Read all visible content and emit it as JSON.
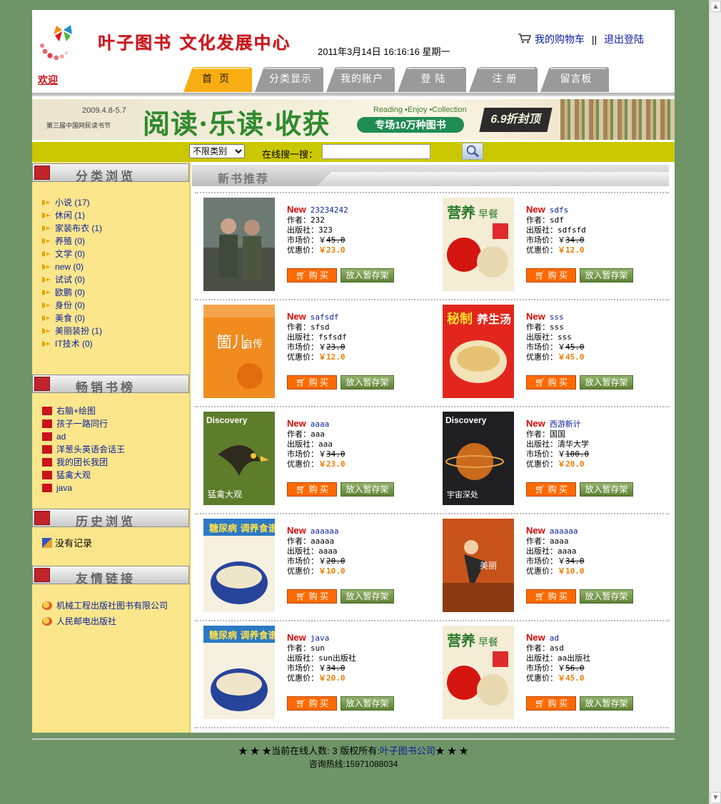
{
  "header": {
    "site_title": "叶子图书 文化发展中心",
    "datetime": "2011年3月14日  16:16:16 星期一",
    "cart_link": "我的购物车",
    "separator": "||",
    "logout_link": "退出登陆",
    "welcome": "欢迎"
  },
  "nav": {
    "tabs": [
      {
        "label": "首页"
      },
      {
        "label": "分类显示"
      },
      {
        "label": "我的账户"
      },
      {
        "label": "登 陆"
      },
      {
        "label": "注 册"
      },
      {
        "label": "留言板"
      }
    ]
  },
  "banner": {
    "date": "2009.4.8-5.7",
    "subtitle": "第三届中国网民读书节",
    "headline": "阅读·乐读·收获",
    "english": "Reading •Enjoy •Collection",
    "promo": "专场10万种图书",
    "discount": "6.9折封顶"
  },
  "search": {
    "category_selected": "不限类别",
    "label": "在线搜一搜：",
    "query": ""
  },
  "sidebar": {
    "category_title": "分类浏览",
    "categories": [
      "小说 (17)",
      "休闲 (1)",
      "家装布衣 (1)",
      "养殖 (0)",
      "文学 (0)",
      "new (0)",
      "试试 (0)",
      "欧鹏 (0)",
      "身份 (0)",
      "美食 (0)",
      "美丽装扮 (1)",
      "IT技术 (0)"
    ],
    "bestseller_title": "畅销书榜",
    "bestsellers": [
      "右脑+绘图",
      "孩子一路同行",
      "ad",
      "洋葱头英语会话王",
      "我的团长我团",
      "猛禽大观",
      "java"
    ],
    "history_title": "历史浏览",
    "history_empty": "没有记录",
    "links_title": "友情链接",
    "links": [
      "机械工程出版社图书有限公司",
      "人民邮电出版社"
    ]
  },
  "main": {
    "section_title": "新书推荐",
    "labels": {
      "new": "New",
      "author": "作者：",
      "publisher": "出版社：",
      "market_price": "市场价：",
      "sale_price": "优惠价：",
      "currency": "￥",
      "buy": "购 买",
      "shelf": "放入暂存架"
    },
    "books": [
      {
        "name": "23234242",
        "author": "232",
        "publisher": "323",
        "market": "45.0",
        "price": "23.0",
        "cover": "soldiers"
      },
      {
        "name": "sdfs",
        "author": "sdf",
        "publisher": "sdfsfd",
        "market": "34.0",
        "price": "12.0",
        "cover": "breakfast"
      },
      {
        "name": "safsdf",
        "author": "sfsd",
        "publisher": "fsfsdf",
        "market": "23.0",
        "price": "12.0",
        "cover": "orange"
      },
      {
        "name": "sss",
        "author": "sss",
        "publisher": "sss",
        "market": "45.0",
        "price": "45.0",
        "cover": "soup"
      },
      {
        "name": "aaaa",
        "author": "aaa",
        "publisher": "aaa",
        "market": "34.0",
        "price": "23.0",
        "cover": "eagle"
      },
      {
        "name": "西游新计",
        "author": "国国",
        "publisher": "清华大学",
        "market": "100.0",
        "price": "20.0",
        "cover": "space"
      },
      {
        "name": "aaaaaa",
        "author": "aaaaa",
        "publisher": "aaaa",
        "market": "20.0",
        "price": "10.0",
        "cover": "stew"
      },
      {
        "name": "aaaaaa",
        "author": "aaaa",
        "publisher": "aaaa",
        "market": "34.0",
        "price": "10.0",
        "cover": "dance"
      },
      {
        "name": "java",
        "author": "sun",
        "publisher": "sun出版社",
        "market": "34.0",
        "price": "20.0",
        "cover": "stew"
      },
      {
        "name": "ad",
        "author": "asd",
        "publisher": "aa出版社",
        "market": "56.0",
        "price": "45.0",
        "cover": "breakfast"
      }
    ]
  },
  "footer": {
    "online_prefix": "★ ★ ★当前在线人数: 3  版权所有:",
    "company": "叶子图书公司",
    "online_suffix": "★ ★ ★",
    "hotline": "咨询热线:15971088034"
  }
}
